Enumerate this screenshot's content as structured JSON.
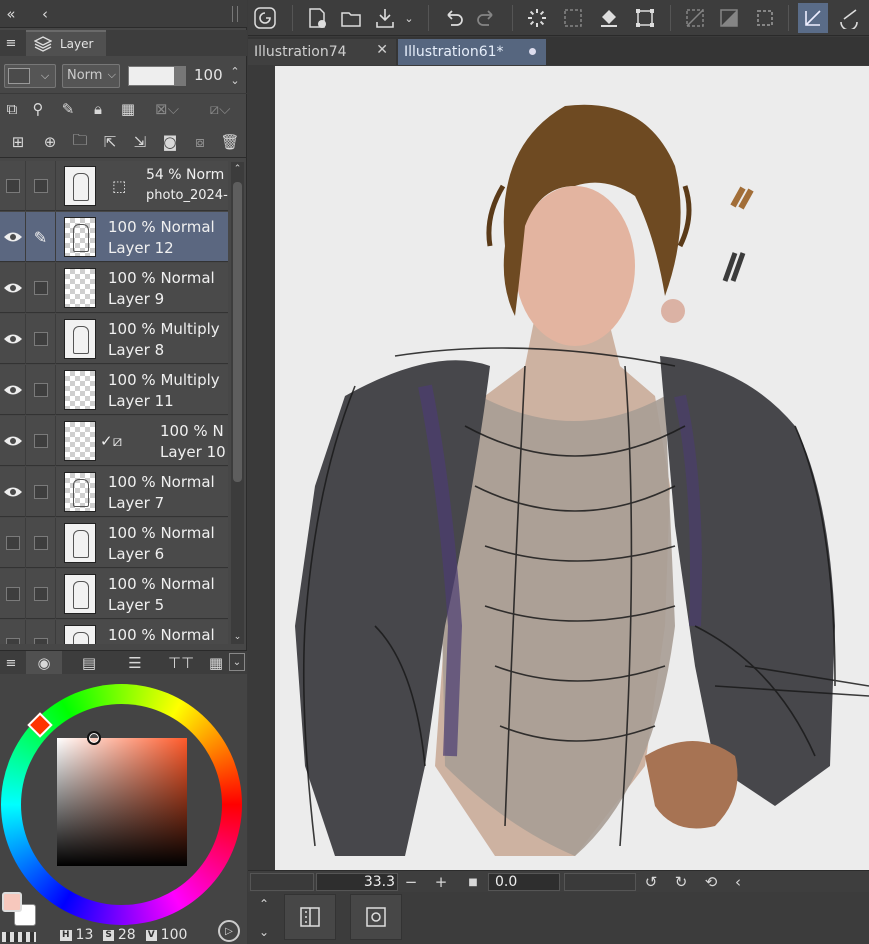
{
  "left_panel": {
    "layer_tab": {
      "label": "Layer"
    },
    "blend_mode": "Norm",
    "opacity": "100",
    "layers": [
      {
        "opacity": "54 %",
        "mode": "Norm",
        "name": "photo_2024-",
        "visible": false,
        "kind": "sketch"
      },
      {
        "opacity": "100 %",
        "mode": "Normal",
        "name": "Layer 12",
        "visible": true,
        "selected": true,
        "kind": "figure"
      },
      {
        "opacity": "100 %",
        "mode": "Normal",
        "name": "Layer 9",
        "visible": true,
        "kind": "empty"
      },
      {
        "opacity": "100 %",
        "mode": "Multiply",
        "name": "Layer 8",
        "visible": true,
        "kind": "sketch"
      },
      {
        "opacity": "100 %",
        "mode": "Multiply",
        "name": "Layer 11",
        "visible": true,
        "kind": "empty"
      },
      {
        "opacity": "100 %",
        "mode": "N",
        "name": "Layer 10",
        "visible": true,
        "kind": "empty"
      },
      {
        "opacity": "100 %",
        "mode": "Normal",
        "name": "Layer 7",
        "visible": true,
        "kind": "figure"
      },
      {
        "opacity": "100 %",
        "mode": "Normal",
        "name": "Layer 6",
        "visible": false,
        "kind": "sketch"
      },
      {
        "opacity": "100 %",
        "mode": "Normal",
        "name": "Layer 5",
        "visible": false,
        "kind": "sketch"
      },
      {
        "opacity": "100 %",
        "mode": "Normal",
        "name": "",
        "visible": false,
        "kind": "sketch"
      }
    ],
    "color": {
      "main": "#f7c8bd",
      "sub": "#ffffff",
      "h_label": "H",
      "h": "13",
      "s_label": "S",
      "s": "28",
      "v_label": "V",
      "v": "100"
    }
  },
  "doc_tabs": [
    {
      "label": "Illustration74",
      "active": false
    },
    {
      "label": "Illustration61*",
      "active": true
    }
  ],
  "status": {
    "zoom": "33.3",
    "rotation": "0.0"
  },
  "canvas": {
    "paper_color": "#ececec",
    "jacket_color": "#47474b",
    "hair_color": "#6e4a22",
    "skin_color": "#d9a586"
  }
}
